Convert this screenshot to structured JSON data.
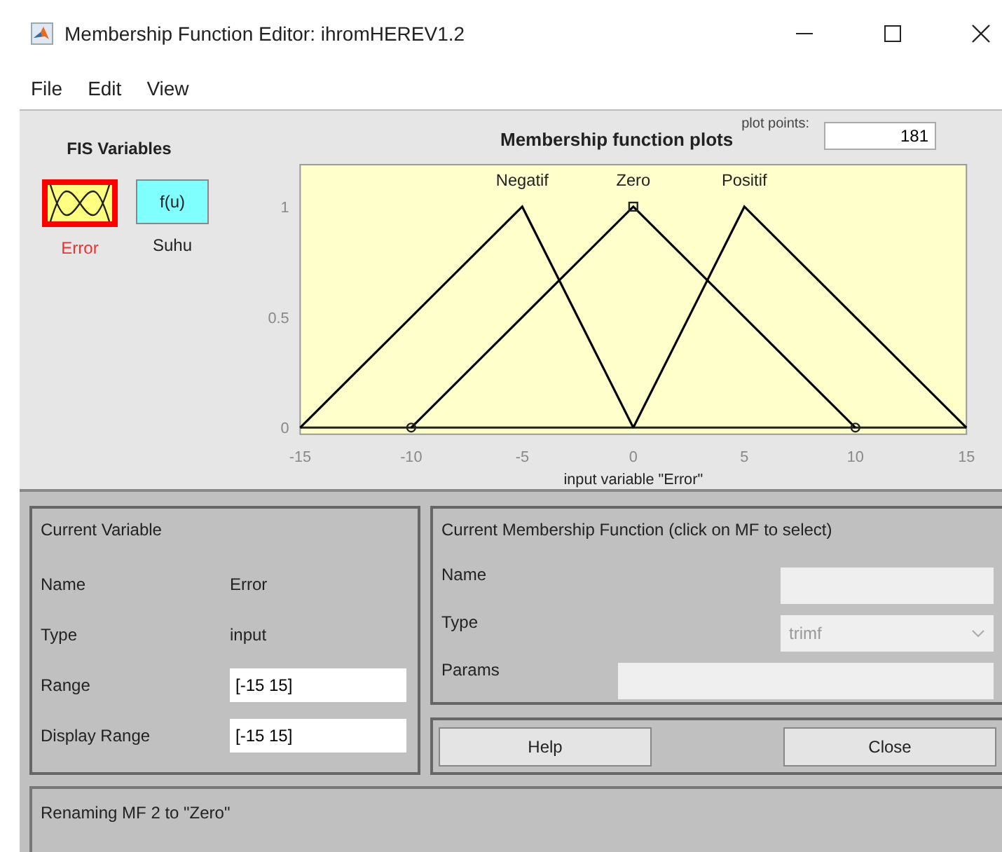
{
  "window": {
    "title": "Membership Function Editor: ihromHEREV1.2"
  },
  "menu": [
    "File",
    "Edit",
    "View"
  ],
  "fis_variables": {
    "title": "FIS Variables",
    "items": [
      {
        "name": "Error",
        "kind": "input",
        "selected": true
      },
      {
        "name": "Suhu",
        "kind": "output",
        "icon_text": "f(u)",
        "selected": false
      }
    ]
  },
  "plot": {
    "plot_points_label": "plot points:",
    "plot_points": "181",
    "chart_data": {
      "type": "line",
      "title": "Membership function plots",
      "xlabel": "input variable \"Error\"",
      "x": [
        -15,
        -10,
        -5,
        0,
        5,
        10,
        15
      ],
      "xlim": [
        -15,
        15
      ],
      "ylim": [
        -0.03,
        1.19
      ],
      "xticks": [
        -15,
        -10,
        -5,
        0,
        5,
        10,
        15
      ],
      "yticks": [
        0,
        0.5,
        1
      ],
      "series": [
        {
          "name": "Negatif",
          "color": "#000000",
          "values": [
            0,
            0.5,
            1,
            0,
            null,
            null,
            null
          ]
        },
        {
          "name": "Zero",
          "color": "#000000",
          "values": [
            null,
            0,
            0.5,
            1,
            0.5,
            0,
            null
          ]
        },
        {
          "name": "Positif",
          "color": "#000000",
          "values": [
            null,
            null,
            null,
            0,
            1,
            0.5,
            0
          ]
        }
      ]
    },
    "mf_selection": [
      {
        "selected": false
      },
      {
        "selected": true
      },
      {
        "selected": false
      }
    ]
  },
  "current_variable": {
    "title": "Current Variable",
    "rows": [
      {
        "label": "Name",
        "kind": "text",
        "value": "Error"
      },
      {
        "label": "Type",
        "kind": "text",
        "value": "input"
      },
      {
        "label": "Range",
        "kind": "field",
        "value": "[-15 15]"
      },
      {
        "label": "Display Range",
        "kind": "field",
        "value": "[-15 15]"
      }
    ]
  },
  "current_mf": {
    "title": "Current Membership Function (click on MF to select)",
    "rows": [
      {
        "label": "Name",
        "kind": "field",
        "disabled": true
      },
      {
        "label": "Type",
        "kind": "dropdown",
        "value": "trimf",
        "disabled": true
      },
      {
        "label": "Params",
        "kind": "wide-field",
        "disabled": true
      }
    ]
  },
  "buttons": [
    "Help",
    "Close"
  ],
  "status_bar": "Renaming MF 2 to \"Zero\""
}
